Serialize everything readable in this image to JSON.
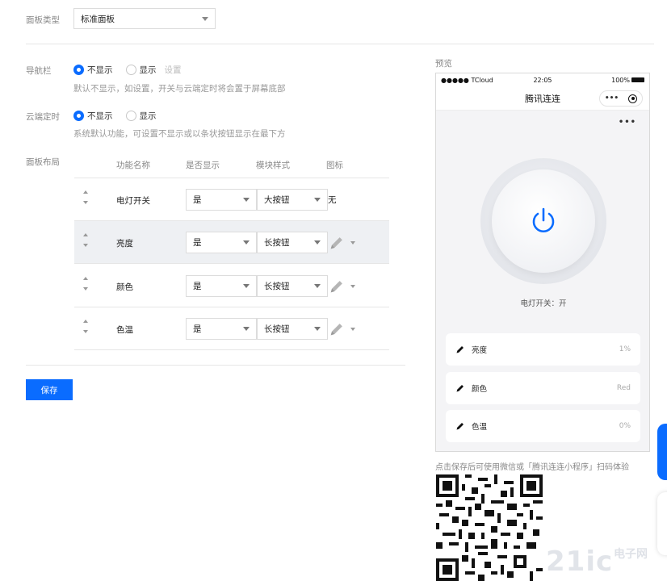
{
  "panel_type": {
    "label": "面板类型",
    "value": "标准面板"
  },
  "navbar_setting": {
    "label": "导航栏",
    "options": [
      "不显示",
      "显示"
    ],
    "selected": "不显示",
    "settings_link": "设置",
    "hint": "默认不显示，如设置，开关与云端定时将会置于屏幕底部"
  },
  "timer_setting": {
    "label": "云端定时",
    "options": [
      "不显示",
      "显示"
    ],
    "selected": "不显示",
    "hint": "系统默认功能，可设置不显示或以条状按钮显示在最下方"
  },
  "layout": {
    "label": "面板布局",
    "headers": [
      "功能名称",
      "是否显示",
      "模块样式",
      "图标"
    ],
    "rows": [
      {
        "name": "电灯开关",
        "show": "是",
        "style": "大按钮",
        "icon": "无",
        "highlighted": false
      },
      {
        "name": "亮度",
        "show": "是",
        "style": "长按钮",
        "icon": "pencil-icon",
        "highlighted": true
      },
      {
        "name": "颜色",
        "show": "是",
        "style": "长按钮",
        "icon": "pencil-icon",
        "highlighted": false
      },
      {
        "name": "色温",
        "show": "是",
        "style": "长按钮",
        "icon": "pencil-icon",
        "highlighted": false
      }
    ]
  },
  "save_label": "保存",
  "preview": {
    "label": "预览",
    "status": {
      "carrier": "●●●●● TCloud",
      "time": "22:05",
      "battery": "100%"
    },
    "title": "腾讯连连",
    "more": "•••",
    "power_label": "电灯开关：开",
    "cards": [
      {
        "name": "亮度",
        "value": "1%"
      },
      {
        "name": "颜色",
        "value": "Red"
      },
      {
        "name": "色温",
        "value": "0%"
      }
    ],
    "scan_hint": "点击保存后可使用微信或「腾讯连连小程序」扫码体验"
  },
  "watermark": {
    "logo": "21ic",
    "sub1": "电子网",
    "sub2": ""
  },
  "colors": {
    "accent": "#0a6cff",
    "border": "#dcdcdc",
    "highlight_row": "#eef0f3"
  }
}
